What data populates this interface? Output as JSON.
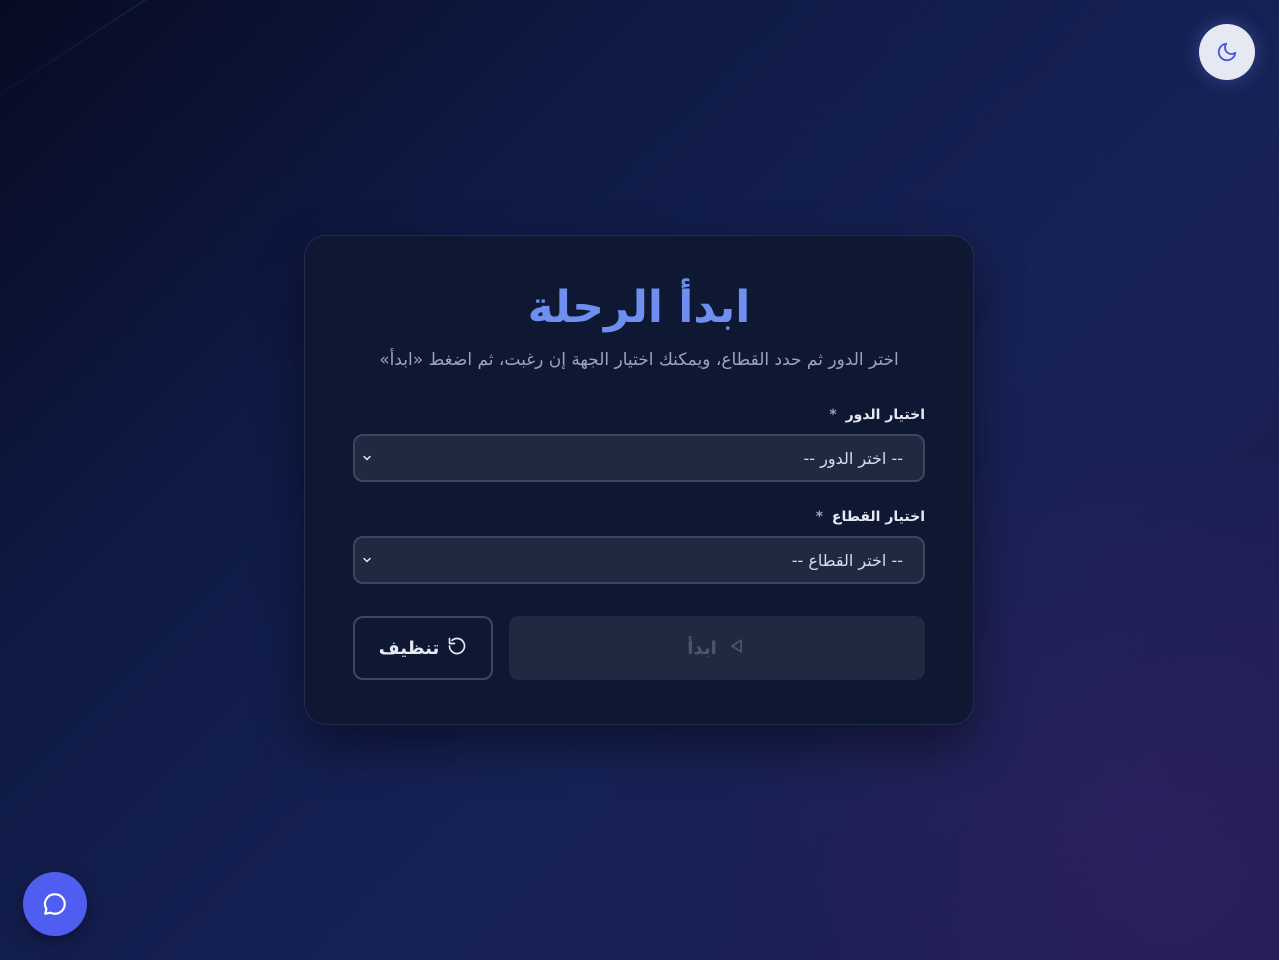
{
  "header": {
    "theme_toggle_icon": "moon-icon"
  },
  "card": {
    "title": "ابدأ الرحلة",
    "subtitle": "اختر الدور ثم حدد القطاع، ويمكنك اختيار الجهة إن رغبت، ثم اضغط «ابدأ»"
  },
  "fields": {
    "role": {
      "label": "اختيار الدور",
      "required_mark": "*",
      "selected": "-- اختر الدور --"
    },
    "sector": {
      "label": "اختيار القطاع",
      "required_mark": "*",
      "selected": "-- اختر القطاع --"
    }
  },
  "actions": {
    "start_label": "ابدأ",
    "clear_label": "تنظيف"
  },
  "chat": {
    "icon": "chat-bubble-icon"
  },
  "colors": {
    "accent": "#6f8ff0",
    "chat_button": "#4f5ef0",
    "card_bg": "#0f1833"
  }
}
